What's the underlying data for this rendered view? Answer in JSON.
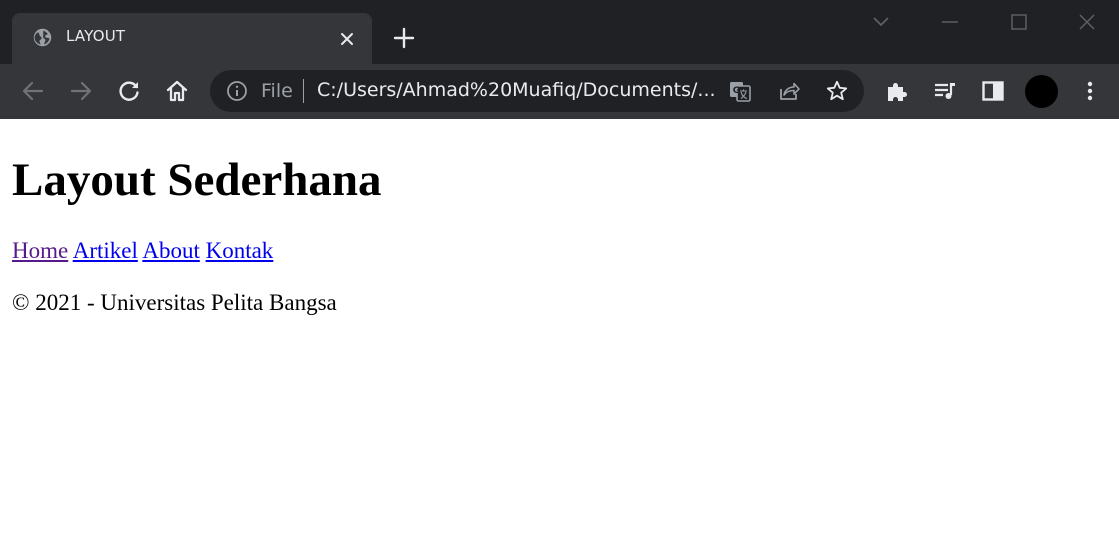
{
  "browser": {
    "tab": {
      "title": "LAYOUT"
    },
    "omnibox": {
      "scheme_label": "File",
      "url": "C:/Users/Ahmad%20Muafiq/Documents/..."
    },
    "icons": {
      "favicon": "globe-icon",
      "tab_close": "close-icon",
      "new_tab": "plus-icon",
      "tab_search": "chevron-down-icon",
      "minimize": "minimize-icon",
      "maximize": "maximize-icon",
      "close_window": "close-icon",
      "back": "arrow-left-icon",
      "forward": "arrow-right-icon",
      "reload": "reload-icon",
      "home": "home-icon",
      "site_info": "info-icon",
      "translate": "translate-icon",
      "share": "share-icon",
      "bookmark": "star-icon",
      "extensions": "puzzle-icon",
      "media": "playlist-icon",
      "side_panel": "side-panel-icon",
      "menu": "kebab-icon"
    },
    "colors": {
      "tabstrip_bg": "#202124",
      "toolbar_bg": "#35363a",
      "icon": "#e8eaed",
      "icon_dim": "#9aa0a6"
    }
  },
  "page": {
    "title": "Layout Sederhana",
    "nav": [
      {
        "label": "Home",
        "visited": true
      },
      {
        "label": "Artikel",
        "visited": false
      },
      {
        "label": "About",
        "visited": false
      },
      {
        "label": "Kontak",
        "visited": false
      }
    ],
    "footer": "© 2021 - Universitas Pelita Bangsa",
    "colors": {
      "link": "#0000ee",
      "link_visited": "#551a8b"
    }
  }
}
